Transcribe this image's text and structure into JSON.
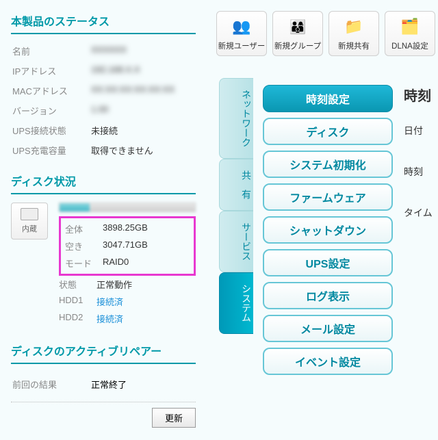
{
  "status": {
    "title": "本製品のステータス",
    "rows": {
      "name": {
        "label": "名前",
        "value": "XXXXXX",
        "blurred": true
      },
      "ip": {
        "label": "IPアドレス",
        "value": "192.168.X.X",
        "blurred": true
      },
      "mac": {
        "label": "MACアドレス",
        "value": "XX:XX:XX:XX:XX:XX",
        "blurred": true
      },
      "version": {
        "label": "バージョン",
        "value": "1.00",
        "blurred": true
      },
      "ups_conn": {
        "label": "UPS接続状態",
        "value": "未接続",
        "blurred": false
      },
      "ups_charge": {
        "label": "UPS充電容量",
        "value": "取得できません",
        "blurred": false
      }
    }
  },
  "disk": {
    "title": "ディスク状況",
    "icon_label": "内蔵",
    "rows": {
      "total": {
        "label": "全体",
        "value": "3898.25GB"
      },
      "free": {
        "label": "空き",
        "value": "3047.71GB"
      },
      "mode": {
        "label": "モード",
        "value": "RAID0"
      },
      "state": {
        "label": "状態",
        "value": "正常動作"
      },
      "hdd1": {
        "label": "HDD1",
        "value": "接続済"
      },
      "hdd2": {
        "label": "HDD2",
        "value": "接続済"
      }
    }
  },
  "repair": {
    "title": "ディスクのアクティブリペアー",
    "last_label": "前回の結果",
    "last_value": "正常終了",
    "update_btn": "更新"
  },
  "toolbar": {
    "new_user": "新規ユーザー",
    "new_group": "新規グループ",
    "new_share": "新規共有",
    "dlna": "DLNA設定"
  },
  "vtabs": {
    "network": "ネットワーク",
    "share": "共　有",
    "service": "サービス",
    "system": "システム"
  },
  "menu": {
    "time": "時刻設定",
    "disk": "ディスク",
    "init": "システム初期化",
    "firmware": "ファームウェア",
    "shutdown": "シャットダウン",
    "ups": "UPS設定",
    "log": "ログ表示",
    "mail": "メール設定",
    "event": "イベント設定"
  },
  "right": {
    "title": "時刻",
    "date": "日付",
    "time": "時刻",
    "tz": "タイム"
  }
}
